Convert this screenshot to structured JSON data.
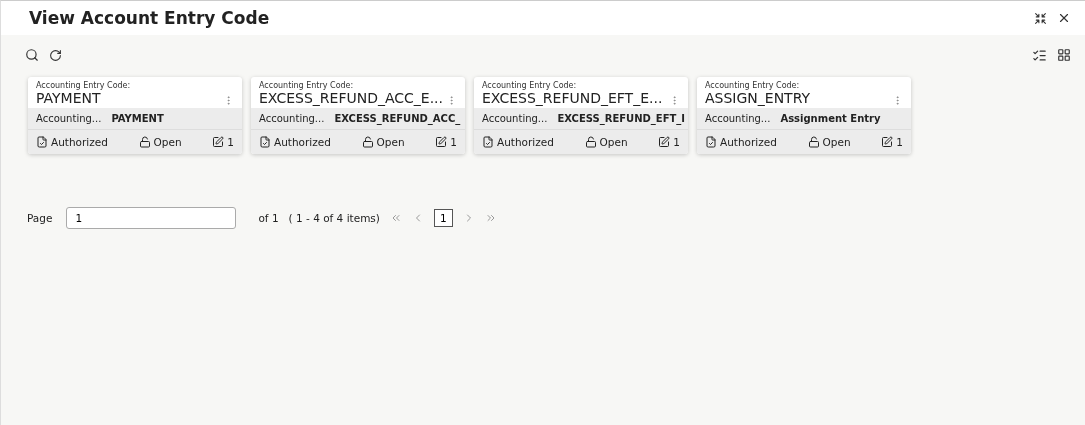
{
  "window": {
    "title": "View Account Entry Code"
  },
  "cards": [
    {
      "label": "Accounting Entry Code:",
      "code": "PAYMENT",
      "desc_label": "Accounting...",
      "desc": "PAYMENT",
      "status": "Authorized",
      "lock": "Open",
      "version": "1"
    },
    {
      "label": "Accounting Entry Code:",
      "code": "EXCESS_REFUND_ACC_E...",
      "desc_label": "Accounting...",
      "desc": "EXCESS_REFUND_ACC_",
      "status": "Authorized",
      "lock": "Open",
      "version": "1"
    },
    {
      "label": "Accounting Entry Code:",
      "code": "EXCESS_REFUND_EFT_E...",
      "desc_label": "Accounting...",
      "desc": "EXCESS_REFUND_EFT_I",
      "status": "Authorized",
      "lock": "Open",
      "version": "1"
    },
    {
      "label": "Accounting Entry Code:",
      "code": "ASSIGN_ENTRY",
      "desc_label": "Accounting...",
      "desc": "Assignment Entry",
      "status": "Authorized",
      "lock": "Open",
      "version": "1"
    }
  ],
  "pagination": {
    "label": "Page",
    "value": "1",
    "of": "of 1",
    "range": "( 1 - 4 of 4 items)",
    "pages": [
      {
        "label": "1",
        "selected": true
      }
    ]
  }
}
